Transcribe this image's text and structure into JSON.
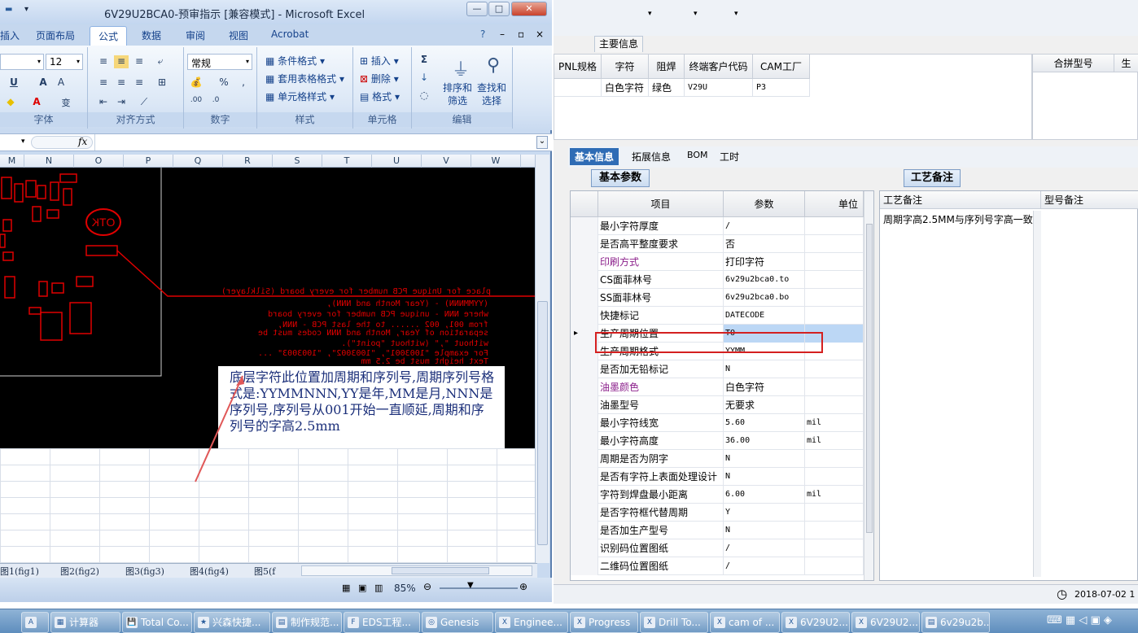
{
  "excel": {
    "title": "6V29U2BCA0-预审指示  [兼容模式] - Microsoft Excel",
    "window_buttons": [
      "▾",
      "—",
      "□",
      "✕"
    ],
    "tabs": [
      "插入",
      "页面布局",
      "公式",
      "数据",
      "审阅",
      "视图",
      "Acrobat"
    ],
    "active_tab": "公式",
    "ribbon": {
      "font_size": "12",
      "number_format": "常规",
      "font_group": "字体",
      "align_group": "对齐方式",
      "number_group": "数字",
      "style_group": "样式",
      "cells_group": "单元格",
      "edit_group": "编辑",
      "cond_format": "条件格式",
      "table_format": "套用表格格式",
      "cell_style": "单元格样式",
      "insert": "插入",
      "delete": "删除",
      "format": "格式",
      "sort_filter": "排序和\n筛选",
      "find_select": "查找和\n选择"
    },
    "formula_fx": "fx",
    "columns": [
      "M",
      "N",
      "O",
      "P",
      "Q",
      "R",
      "S",
      "T",
      "U",
      "V",
      "W"
    ],
    "pcb_text": [
      "place for Unique PCB number for every board (Silklayer)",
      "(YYMMNNN)  -  (Year Month and NNN),",
      "where NNN - unique PCB number for every board",
      "from 001, 002 ...... to the last PCB - NNN,",
      "separation of Year, Month and NNN codes must be",
      "without \",\" (without \"point\").",
      "For example \"1003001\", \"1003002\", \"1003003\" ...",
      "Text height must be 2.5 mm"
    ],
    "pcb_logo": "OTK",
    "callout": "底层字符此位置加周期和序列号,周期序列号格式是:YYMMNNN,YY是年,MM是月,NNN是序列号,序列号从001开始一直顺延,周期和序列号的字高2.5mm",
    "sheet_tabs": [
      "图1(fig1)",
      "图2(fig2)",
      "图3(fig3)",
      "图4(fig4)",
      "图5(f"
    ],
    "zoom": "85%"
  },
  "app": {
    "main_info_tab": "主要信息",
    "main_headers": [
      "PNL规格",
      "字符",
      "阻焊",
      "终端客户代码",
      "CAM工厂"
    ],
    "main_values": [
      "",
      "白色字符",
      "绿色",
      "V29U",
      "P3"
    ],
    "merge_header": "合拼型号",
    "merge_header2": "生",
    "tabs": [
      "基本信息",
      "拓展信息",
      "BOM",
      "工时"
    ],
    "basic_params_tab": "基本参数",
    "process_tab": "工艺备注",
    "param_headers": [
      "项目",
      "参数",
      "单位"
    ],
    "params": [
      {
        "item": "最小字符厚度",
        "value": "/",
        "unit": "",
        "color": "#000000"
      },
      {
        "item": "是否高平整度要求",
        "value": "否",
        "unit": "",
        "color": "#000000"
      },
      {
        "item": "印刷方式",
        "value": "打印字符",
        "unit": "",
        "color": "#8b1f8b"
      },
      {
        "item": "CS面菲林号",
        "value": "6v29u2bca0.to",
        "unit": "",
        "color": "#000000"
      },
      {
        "item": "SS面菲林号",
        "value": "6v29u2bca0.bo",
        "unit": "",
        "color": "#000000"
      },
      {
        "item": "快捷标记",
        "value": "DATECODE",
        "unit": "",
        "color": "#000000"
      },
      {
        "item": "生产周期位置",
        "value": "TO",
        "unit": "",
        "color": "#000000"
      },
      {
        "item": "生产周期格式",
        "value": "YYMM",
        "unit": "",
        "color": "#000000"
      },
      {
        "item": "是否加无铅标记",
        "value": "N",
        "unit": "",
        "color": "#000000"
      },
      {
        "item": "油墨颜色",
        "value": "白色字符",
        "unit": "",
        "color": "#8b1f8b"
      },
      {
        "item": "油墨型号",
        "value": "无要求",
        "unit": "",
        "color": "#000000"
      },
      {
        "item": "最小字符线宽",
        "value": "5.60",
        "unit": "mil",
        "color": "#000000"
      },
      {
        "item": "最小字符高度",
        "value": "36.00",
        "unit": "mil",
        "color": "#000000"
      },
      {
        "item": "周期是否为阴字",
        "value": "N",
        "unit": "",
        "color": "#000000"
      },
      {
        "item": "是否有字符上表面处理设计",
        "value": "N",
        "unit": "",
        "color": "#000000"
      },
      {
        "item": "字符到焊盘最小距离",
        "value": "6.00",
        "unit": "mil",
        "color": "#000000"
      },
      {
        "item": "是否字符框代替周期",
        "value": "Y",
        "unit": "",
        "color": "#000000"
      },
      {
        "item": "是否加生产型号",
        "value": "N",
        "unit": "",
        "color": "#000000"
      },
      {
        "item": "识别码位置图纸",
        "value": "/",
        "unit": "",
        "color": "#000000"
      },
      {
        "item": "二维码位置图纸",
        "value": "/",
        "unit": "",
        "color": "#000000"
      }
    ],
    "process_headers": [
      "工艺备注",
      "型号备注"
    ],
    "process_note": "周期字高2.5MM与序列号字高一致",
    "status_date": "2018-07-02 1"
  },
  "taskbar": [
    {
      "label": "",
      "icon": "A"
    },
    {
      "label": "计算器",
      "icon": "▦"
    },
    {
      "label": "Total Co...",
      "icon": "💾"
    },
    {
      "label": "兴森快捷...",
      "icon": "★"
    },
    {
      "label": "制作规范...",
      "icon": "▤"
    },
    {
      "label": "EDS工程...",
      "icon": "F"
    },
    {
      "label": "Genesis",
      "icon": "◎"
    },
    {
      "label": "Enginee...",
      "icon": "X"
    },
    {
      "label": "Progress",
      "icon": "X"
    },
    {
      "label": "Drill To...",
      "icon": "X"
    },
    {
      "label": "cam of ...",
      "icon": "X"
    },
    {
      "label": "6V29U2...",
      "icon": "X"
    },
    {
      "label": "6V29U2...",
      "icon": "X"
    },
    {
      "label": "6v29u2b...",
      "icon": "▤"
    }
  ],
  "colors": {
    "accent": "#2a5d9c",
    "pcb_red": "#e00000",
    "highlight": "#d42020"
  }
}
